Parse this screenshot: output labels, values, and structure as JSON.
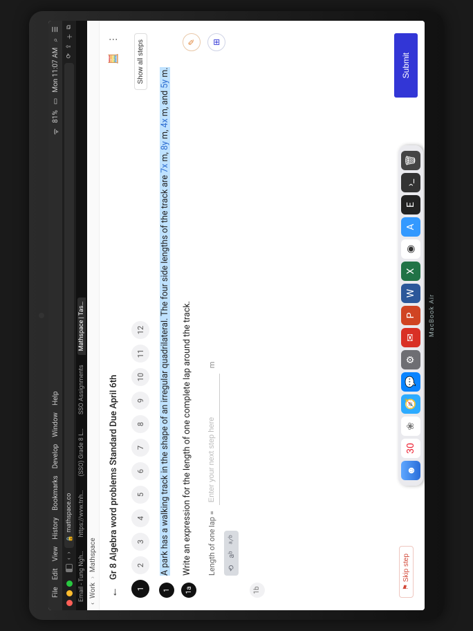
{
  "mac_menu": {
    "apple": "",
    "items": [
      "File",
      "Edit",
      "View",
      "History",
      "Bookmarks",
      "Develop",
      "Window",
      "Help"
    ],
    "wifi": "81%",
    "clock": "Mon 11:07 AM"
  },
  "browser": {
    "address_host": "mathspace.co",
    "tabs": [
      "Email - Tung Ngh…",
      "https://wvw.tnh…",
      "(SSO) Grade 8 L…",
      "SSO Assignments",
      "Mathspace | Tas…"
    ],
    "active_tab": 4
  },
  "breadcrumb": {
    "a": "Work",
    "b": "Mathspace"
  },
  "page": {
    "title": "Gr 8 Algebra word problems Standard Due April 6th",
    "show_all": "Show all steps",
    "steps": [
      "1",
      "2",
      "3",
      "4",
      "5",
      "6",
      "7",
      "8",
      "9",
      "10",
      "11",
      "12"
    ],
    "active_step": 0,
    "q1_bullet": "1",
    "q1_pre": "A park has a walking track in the shape of an irregular quadrilateral. The four side lengths of the track are ",
    "q1_v1": "7x",
    "q1_m1": " m, ",
    "q1_v2": "8y",
    "q1_m2": " m, ",
    "q1_v3": "4x",
    "q1_m3": " m, and ",
    "q1_v4": "5y",
    "q1_post": " m.",
    "q1a_bullet": "1a",
    "q1a_text": "Write an expression for the length of one complete lap around the track.",
    "ans_label": "Length of one lap =",
    "ans_placeholder": "Enter your next step here",
    "ans_unit": "m",
    "skip": "Skip step",
    "submit": "Submit",
    "tool1": "⟲",
    "tool2": "aᵇ",
    "tool3": "ᵃ⁄ᵇ",
    "chip_label": "1b"
  },
  "hinge": "MacBook Air"
}
